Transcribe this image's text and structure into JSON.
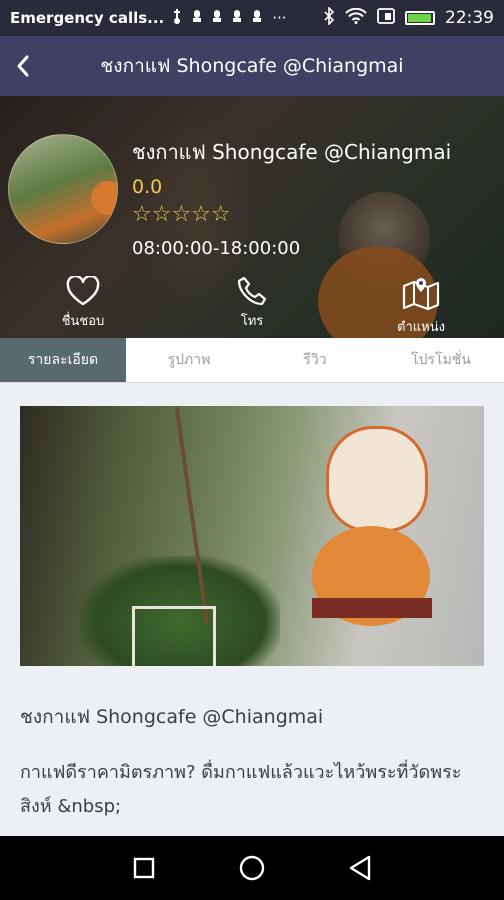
{
  "status_bar": {
    "carrier_text": "Emergency calls...",
    "time": "22:39",
    "battery_level": 0.95,
    "icons": [
      "usb-icon",
      "notification-icon",
      "notification-icon",
      "notification-icon",
      "notification-icon",
      "more-icon",
      "bluetooth-icon",
      "wifi-icon",
      "sim-icon",
      "battery-icon"
    ]
  },
  "app_bar": {
    "title": "ชงกาแฟ Shongcafe @Chiangmai",
    "back_icon": "back-arrow-icon"
  },
  "shop": {
    "name": "ชงกาแฟ Shongcafe @Chiangmai",
    "rating": "0.0",
    "stars_filled": 0,
    "stars_total": 5,
    "stars_text": "☆☆☆☆☆",
    "hours": "08:00:00-18:00:00"
  },
  "actions": {
    "favorite": {
      "label": "ชื่นชอบ",
      "icon": "heart-icon"
    },
    "call": {
      "label": "โทร",
      "icon": "phone-icon"
    },
    "location": {
      "label": "ตำแหน่ง",
      "icon": "map-icon"
    }
  },
  "tabs": [
    {
      "label": "รายละเอียด",
      "active": true
    },
    {
      "label": "รูปภาพ",
      "active": false
    },
    {
      "label": "รีวิว",
      "active": false
    },
    {
      "label": "โปรโมชั่น",
      "active": false
    }
  ],
  "detail": {
    "title": "ชงกาแฟ Shongcafe @Chiangmai",
    "description": "กาแฟดีราคามิตรภาพ? ดื่มกาแฟแล้วแวะไหว้พระที่วัดพระสิงห์ &nbsp;"
  },
  "colors": {
    "app_bar": "#3f4063",
    "status_bar": "#2a2b3a",
    "active_tab": "#58696f",
    "rating": "#f2c84b"
  }
}
